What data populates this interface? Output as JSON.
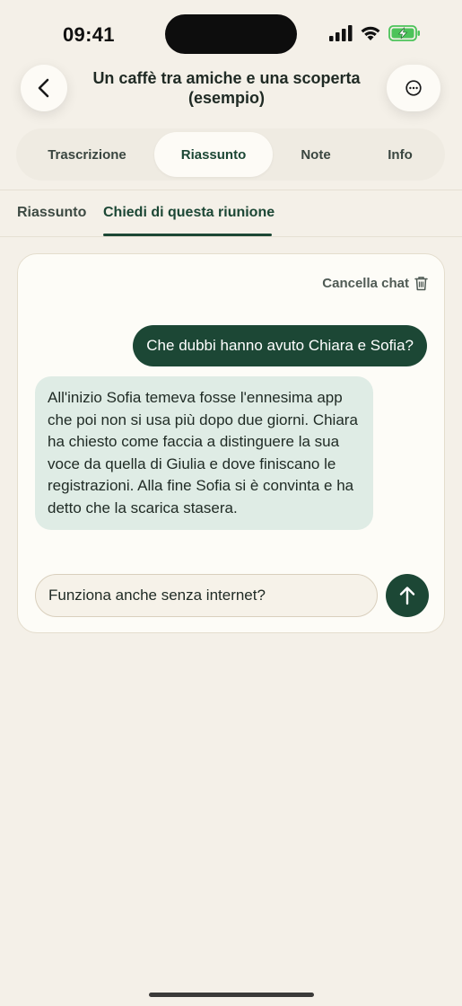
{
  "status_bar": {
    "time": "09:41"
  },
  "header": {
    "title": "Un caffè tra amiche e una scoperta (esempio)",
    "back_icon": "chevron-left-icon",
    "more_icon": "ellipsis-circle-icon"
  },
  "segmented_tabs": {
    "items": [
      {
        "label": "Trascrizione"
      },
      {
        "label": "Riassunto"
      },
      {
        "label": "Note"
      },
      {
        "label": "Info"
      }
    ],
    "active": "Riassunto"
  },
  "sub_tabs": {
    "items": [
      {
        "label": "Riassunto"
      },
      {
        "label": "Chiedi di questa riunione"
      }
    ],
    "active": "Chiedi di questa riunione"
  },
  "chat": {
    "clear_label": "Cancella chat",
    "clear_icon": "trash-icon",
    "messages": [
      {
        "role": "user",
        "text": "Che dubbi hanno avuto Chiara e Sofia?"
      },
      {
        "role": "assistant",
        "text": "All'inizio Sofia temeva fosse l'ennesima app che poi non si usa più dopo due giorni. Chiara ha chiesto come faccia a distinguere la sua voce da quella di Giulia e dove finiscano le registrazioni. Alla fine Sofia si è convinta e ha detto che la scarica stasera."
      }
    ],
    "input_value": "Funziona anche senza internet?",
    "send_icon": "arrow-up-icon"
  },
  "colors": {
    "background": "#f4f0e8",
    "accent": "#1c4735",
    "assistant_bubble": "#dfece5",
    "card": "#fdfcf7"
  }
}
